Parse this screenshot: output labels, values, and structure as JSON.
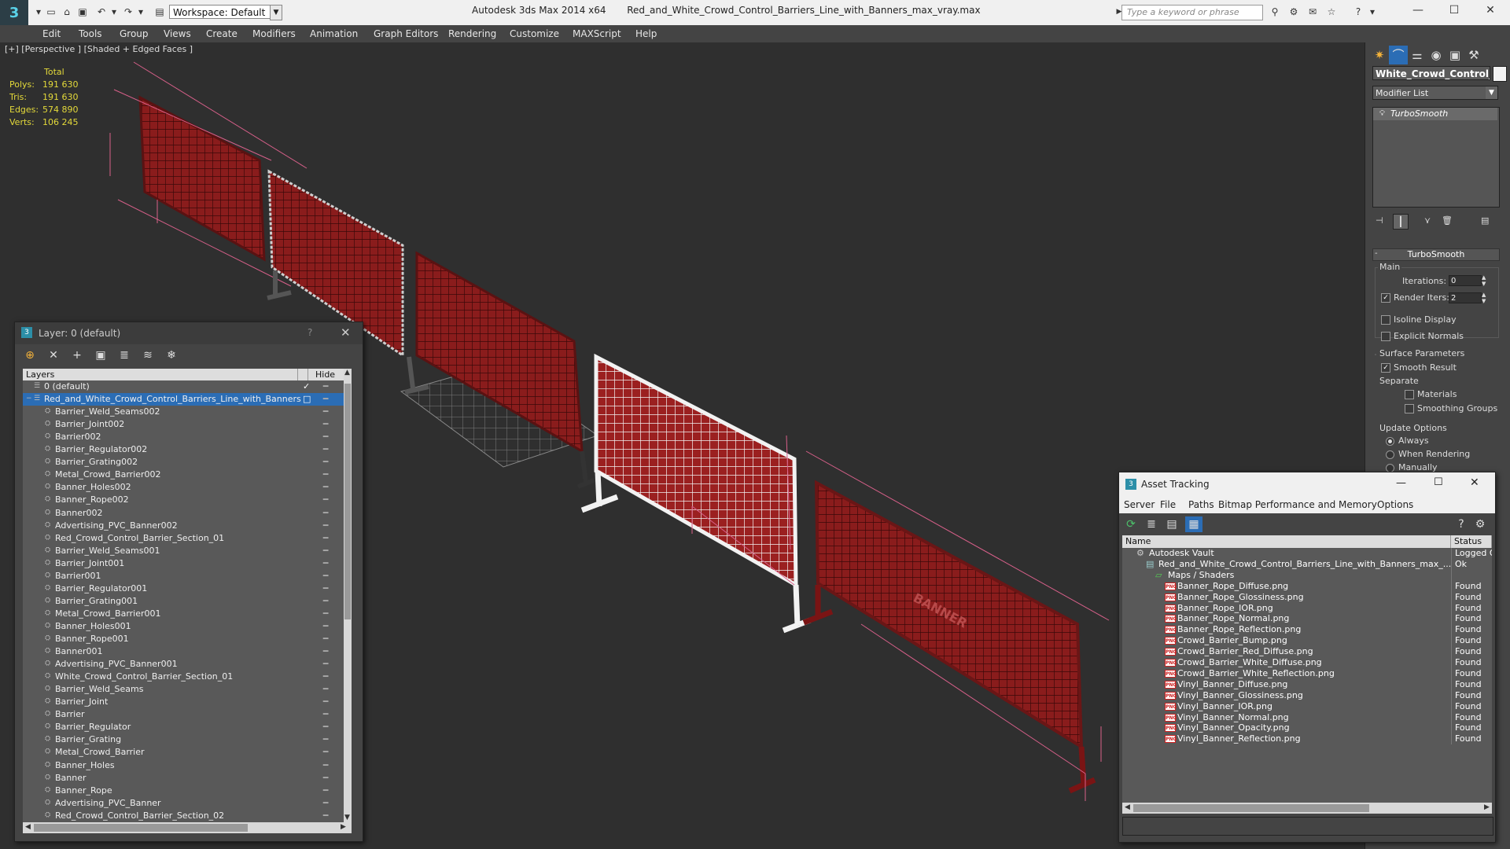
{
  "titlebar": {
    "workspace": "Workspace: Default",
    "app_title": "Autodesk 3ds Max  2014 x64",
    "file_name": "Red_and_White_Crowd_Control_Barriers_Line_with_Banners_max_vray.max",
    "search_placeholder": "Type a keyword or phrase"
  },
  "menu": [
    "Edit",
    "Tools",
    "Group",
    "Views",
    "Create",
    "Modifiers",
    "Animation",
    "Graph Editors",
    "Rendering",
    "Customize",
    "MAXScript",
    "Help"
  ],
  "viewport": {
    "label": "[+] [Perspective ] [Shaded + Edged Faces ]",
    "stats_header": "Total",
    "stats": [
      {
        "label": "Polys:",
        "value": "191 630"
      },
      {
        "label": "Tris:",
        "value": "191 630"
      },
      {
        "label": "Edges:",
        "value": "574 890"
      },
      {
        "label": "Verts:",
        "value": "106 245"
      }
    ],
    "banner_text": "BANNER"
  },
  "command_panel": {
    "object_name": "White_Crowd_Control_Ba",
    "modifier_list": "Modifier List",
    "stack_item": "TurboSmooth",
    "rollout_title": "TurboSmooth",
    "main_label": "Main",
    "iterations_label": "Iterations:",
    "iterations_value": "0",
    "render_iters_label": "Render Iters:",
    "render_iters_value": "2",
    "isoline_label": "Isoline Display",
    "explicit_normals_label": "Explicit Normals",
    "surface_params_label": "Surface Parameters",
    "smooth_result_label": "Smooth Result",
    "separate_label": "Separate",
    "materials_label": "Materials",
    "smoothing_groups_label": "Smoothing Groups",
    "update_options_label": "Update Options",
    "always_label": "Always",
    "when_rendering_label": "When Rendering",
    "manually_label": "Manually"
  },
  "layer_window": {
    "title": "Layer: 0 (default)",
    "help": "?",
    "col_layers": "Layers",
    "col_hide": "Hide",
    "rows": [
      {
        "name": "0 (default)",
        "level": 1,
        "checked": true
      },
      {
        "name": "Red_and_White_Crowd_Control_Barriers_Line_with_Banners",
        "level": 1,
        "selected": true
      },
      {
        "name": "Barrier_Weld_Seams002",
        "level": 2
      },
      {
        "name": "Barrier_Joint002",
        "level": 2
      },
      {
        "name": "Barrier002",
        "level": 2
      },
      {
        "name": "Barrier_Regulator002",
        "level": 2
      },
      {
        "name": "Barrier_Grating002",
        "level": 2
      },
      {
        "name": "Metal_Crowd_Barrier002",
        "level": 2
      },
      {
        "name": "Banner_Holes002",
        "level": 2
      },
      {
        "name": "Banner_Rope002",
        "level": 2
      },
      {
        "name": "Banner002",
        "level": 2
      },
      {
        "name": "Advertising_PVC_Banner002",
        "level": 2
      },
      {
        "name": "Red_Crowd_Control_Barrier_Section_01",
        "level": 2
      },
      {
        "name": "Barrier_Weld_Seams001",
        "level": 2
      },
      {
        "name": "Barrier_Joint001",
        "level": 2
      },
      {
        "name": "Barrier001",
        "level": 2
      },
      {
        "name": "Barrier_Regulator001",
        "level": 2
      },
      {
        "name": "Barrier_Grating001",
        "level": 2
      },
      {
        "name": "Metal_Crowd_Barrier001",
        "level": 2
      },
      {
        "name": "Banner_Holes001",
        "level": 2
      },
      {
        "name": "Banner_Rope001",
        "level": 2
      },
      {
        "name": "Banner001",
        "level": 2
      },
      {
        "name": "Advertising_PVC_Banner001",
        "level": 2
      },
      {
        "name": "White_Crowd_Control_Barrier_Section_01",
        "level": 2
      },
      {
        "name": "Barrier_Weld_Seams",
        "level": 2
      },
      {
        "name": "Barrier_Joint",
        "level": 2
      },
      {
        "name": "Barrier",
        "level": 2
      },
      {
        "name": "Barrier_Regulator",
        "level": 2
      },
      {
        "name": "Barrier_Grating",
        "level": 2
      },
      {
        "name": "Metal_Crowd_Barrier",
        "level": 2
      },
      {
        "name": "Banner_Holes",
        "level": 2
      },
      {
        "name": "Banner",
        "level": 2
      },
      {
        "name": "Banner_Rope",
        "level": 2
      },
      {
        "name": "Advertising_PVC_Banner",
        "level": 2
      },
      {
        "name": "Red_Crowd_Control_Barrier_Section_02",
        "level": 2
      }
    ]
  },
  "asset_window": {
    "title": "Asset Tracking",
    "menu": [
      "Server",
      "File",
      "Paths",
      "Bitmap Performance and Memory",
      "Options"
    ],
    "col_name": "Name",
    "col_status": "Status",
    "rows": [
      {
        "name": "Autodesk Vault",
        "status": "Logged O",
        "indent": 18,
        "icon": "vault"
      },
      {
        "name": "Red_and_White_Crowd_Control_Barriers_Line_with_Banners_max_...",
        "status": "Ok",
        "indent": 30,
        "icon": "file"
      },
      {
        "name": "Maps / Shaders",
        "status": "",
        "indent": 42,
        "icon": "maps"
      },
      {
        "name": "Banner_Rope_Diffuse.png",
        "status": "Found",
        "indent": 54,
        "icon": "png"
      },
      {
        "name": "Banner_Rope_Glossiness.png",
        "status": "Found",
        "indent": 54,
        "icon": "png"
      },
      {
        "name": "Banner_Rope_IOR.png",
        "status": "Found",
        "indent": 54,
        "icon": "png"
      },
      {
        "name": "Banner_Rope_Normal.png",
        "status": "Found",
        "indent": 54,
        "icon": "png"
      },
      {
        "name": "Banner_Rope_Reflection.png",
        "status": "Found",
        "indent": 54,
        "icon": "png"
      },
      {
        "name": "Crowd_Barrier_Bump.png",
        "status": "Found",
        "indent": 54,
        "icon": "png"
      },
      {
        "name": "Crowd_Barrier_Red_Diffuse.png",
        "status": "Found",
        "indent": 54,
        "icon": "png"
      },
      {
        "name": "Crowd_Barrier_White_Diffuse.png",
        "status": "Found",
        "indent": 54,
        "icon": "png"
      },
      {
        "name": "Crowd_Barrier_White_Reflection.png",
        "status": "Found",
        "indent": 54,
        "icon": "png"
      },
      {
        "name": "Vinyl_Banner_Diffuse.png",
        "status": "Found",
        "indent": 54,
        "icon": "png"
      },
      {
        "name": "Vinyl_Banner_Glossiness.png",
        "status": "Found",
        "indent": 54,
        "icon": "png"
      },
      {
        "name": "Vinyl_Banner_IOR.png",
        "status": "Found",
        "indent": 54,
        "icon": "png"
      },
      {
        "name": "Vinyl_Banner_Normal.png",
        "status": "Found",
        "indent": 54,
        "icon": "png"
      },
      {
        "name": "Vinyl_Banner_Opacity.png",
        "status": "Found",
        "indent": 54,
        "icon": "png"
      },
      {
        "name": "Vinyl_Banner_Reflection.png",
        "status": "Found",
        "indent": 54,
        "icon": "png"
      }
    ]
  },
  "colors": {
    "accent": "#2b6db5",
    "stats": "#e3d93a",
    "barrier_red": "#8a1c1c",
    "barrier_white": "#f2f2f2"
  }
}
